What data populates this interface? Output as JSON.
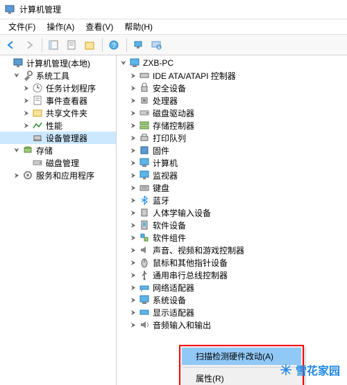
{
  "window": {
    "title": "计算机管理"
  },
  "menu": {
    "file": "文件(F)",
    "action": "操作(A)",
    "view": "查看(V)",
    "help": "帮助(H)"
  },
  "left_tree": {
    "root": "计算机管理(本地)",
    "system_tools": "系统工具",
    "task_scheduler": "任务计划程序",
    "event_viewer": "事件查看器",
    "shared_folders": "共享文件夹",
    "performance": "性能",
    "device_manager": "设备管理器",
    "storage": "存储",
    "disk_management": "磁盘管理",
    "services_apps": "服务和应用程序"
  },
  "right_tree": {
    "root": "ZXB-PC",
    "ide": "IDE ATA/ATAPI 控制器",
    "security": "安全设备",
    "processors": "处理器",
    "disk_drives": "磁盘驱动器",
    "storage_ctrl": "存储控制器",
    "print_queue": "打印队列",
    "firmware": "固件",
    "computer": "计算机",
    "monitors": "监视器",
    "keyboards": "键盘",
    "bluetooth": "蓝牙",
    "biometric": "人体学输入设备",
    "software_dev": "软件设备",
    "software_comp": "软件组件",
    "sound": "声音、视频和游戏控制器",
    "mouse": "鼠标和其他指针设备",
    "usb": "通用串行总线控制器",
    "network": "网络适配器",
    "system_dev": "系统设备",
    "display": "显示适配器",
    "audio_io": "音频输入和输出"
  },
  "context_menu": {
    "scan": "扫描检测硬件改动(A)",
    "properties": "属性(R)"
  },
  "watermark": {
    "text": "雪花家园"
  }
}
